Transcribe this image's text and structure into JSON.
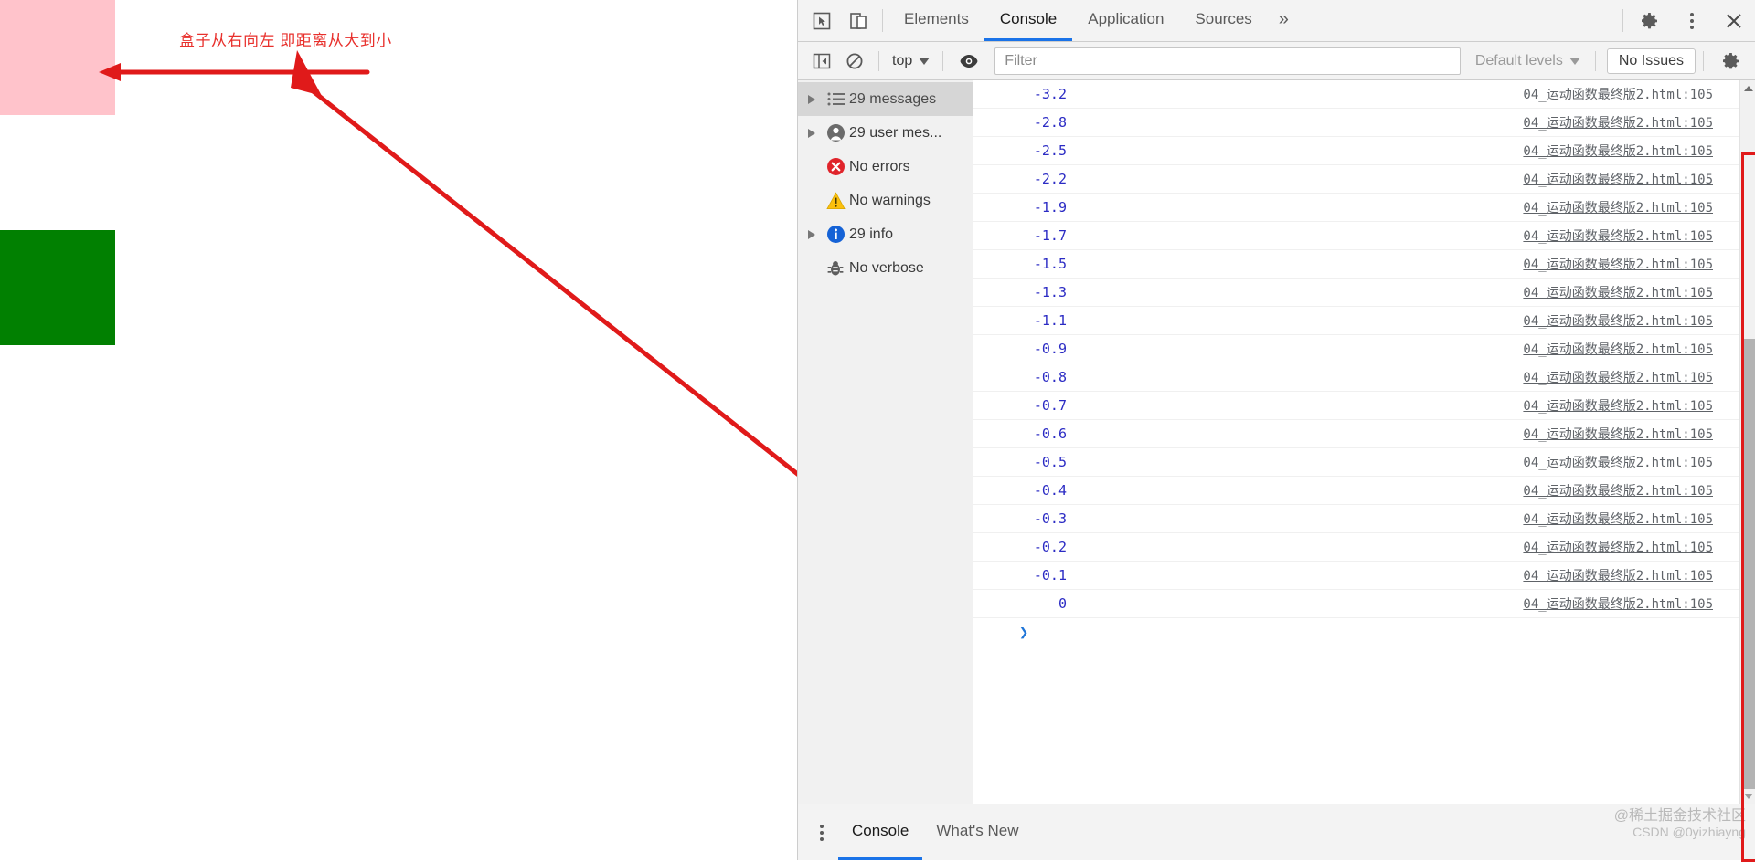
{
  "page": {
    "boxes": [
      {
        "name": "pink-box",
        "color": "#ffc3cb"
      },
      {
        "name": "green-box",
        "color": "#018001"
      }
    ],
    "annotation": {
      "text": "盒子从右向左 即距离从大到小",
      "color": "#e8302c"
    }
  },
  "devtools": {
    "tabs": [
      {
        "label": "Elements",
        "active": false
      },
      {
        "label": "Console",
        "active": true
      },
      {
        "label": "Application",
        "active": false
      },
      {
        "label": "Sources",
        "active": false
      }
    ],
    "overflow_label": "»",
    "toolbar": {
      "context": "top",
      "filter_placeholder": "Filter",
      "filter_value": "",
      "levels_label": "Default levels",
      "issues_label": "No Issues"
    },
    "sidebar": {
      "items": [
        {
          "label": "29 messages",
          "icon": "list-icon",
          "twisty": true,
          "selected": true
        },
        {
          "label": "29 user mes...",
          "icon": "person-icon",
          "twisty": true,
          "selected": false
        },
        {
          "label": "No errors",
          "icon": "error-icon",
          "twisty": false,
          "selected": false
        },
        {
          "label": "No warnings",
          "icon": "warning-icon",
          "twisty": false,
          "selected": false
        },
        {
          "label": "29 info",
          "icon": "info-icon",
          "twisty": true,
          "selected": false
        },
        {
          "label": "No verbose",
          "icon": "bug-icon",
          "twisty": false,
          "selected": false
        }
      ]
    },
    "log": {
      "source": "04_运动函数最终版2.html:105",
      "values": [
        "-3.2",
        "-2.8",
        "-2.5",
        "-2.2",
        "-1.9",
        "-1.7",
        "-1.5",
        "-1.3",
        "-1.1",
        "-0.9",
        "-0.8",
        "-0.7",
        "-0.6",
        "-0.5",
        "-0.4",
        "-0.3",
        "-0.2",
        "-0.1",
        "0"
      ],
      "prompt_caret": "❯",
      "value_color": "#2b2bc4"
    },
    "drawer": {
      "tabs": [
        {
          "label": "Console",
          "active": true
        },
        {
          "label": "What's New",
          "active": false
        }
      ]
    }
  },
  "watermark": {
    "line1": "@稀土掘金技术社区",
    "line2": "CSDN @0yizhiayng"
  }
}
